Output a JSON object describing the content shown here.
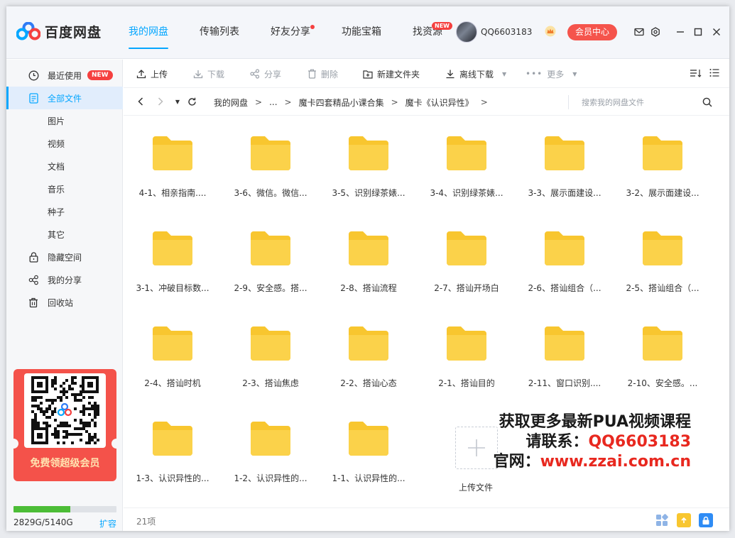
{
  "app": {
    "name": "百度网盘"
  },
  "nav": {
    "items": [
      {
        "label": "我的网盘",
        "active": true
      },
      {
        "label": "传输列表"
      },
      {
        "label": "好友分享",
        "dot": true
      },
      {
        "label": "功能宝箱"
      },
      {
        "label": "找资源",
        "tag": "NEW"
      }
    ]
  },
  "user": {
    "name": "QQ6603183",
    "member_button": "会员中心"
  },
  "sidebar": {
    "items": [
      {
        "label": "最近使用",
        "tag": "NEW"
      },
      {
        "label": "全部文件"
      },
      {
        "label": "图片"
      },
      {
        "label": "视频"
      },
      {
        "label": "文档"
      },
      {
        "label": "音乐"
      },
      {
        "label": "种子"
      },
      {
        "label": "其它"
      },
      {
        "label": "隐藏空间"
      },
      {
        "label": "我的分享"
      },
      {
        "label": "回收站"
      }
    ],
    "promo": "免费领超级会员",
    "quota": {
      "text": "2829G/5140G",
      "expand": "扩容",
      "used_fraction": 0.55
    }
  },
  "toolbar": {
    "upload": "上传",
    "download": "下载",
    "share": "分享",
    "delete": "删除",
    "new_folder": "新建文件夹",
    "offline_download": "离线下载",
    "more": "更多"
  },
  "breadcrumb": {
    "items": [
      "我的网盘",
      "...",
      "魔卡四套精品小课合集",
      "魔卡《认识异性》"
    ],
    "separator": ">"
  },
  "search": {
    "placeholder": "搜索我的网盘文件"
  },
  "files": [
    "4-1、相亲指南....",
    "3-6、微信。微信...",
    "3-5、识别绿茶婊...",
    "3-4、识别绿茶婊...",
    "3-3、展示面建设...",
    "3-2、展示面建设...",
    "3-1、冲破目标数...",
    "2-9、安全感。搭...",
    "2-8、搭讪流程",
    "2-7、搭讪开场白",
    "2-6、搭讪组合（...",
    "2-5、搭讪组合（...",
    "2-4、搭讪时机",
    "2-3、搭讪焦虑",
    "2-2、搭讪心态",
    "2-1、搭讪目的",
    "2-11、窗口识别....",
    "2-10、安全感。...",
    "1-3、认识异性的...",
    "1-2、认识异性的...",
    "1-1、认识异性的..."
  ],
  "upload_tile": {
    "label": "上传文件"
  },
  "watermark": {
    "line1": "获取更多最新PUA视频课程",
    "line2_prefix": "请联系：",
    "line2_value": "QQ6603183",
    "line3_prefix": "官网：",
    "line3_value": "www.zzai.com.cn"
  },
  "status": {
    "count": "21项"
  },
  "colors": {
    "accent": "#06a7ff",
    "folder": "#f8c62f",
    "danger": "#f5403f"
  }
}
